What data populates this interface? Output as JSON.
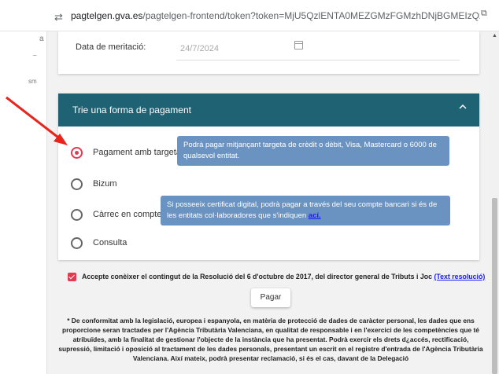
{
  "browser": {
    "url_host": "pagtelgen.gva.es",
    "url_rest": "/pagtelgen-frontend/token?token=MjU5QzlENTA0MEZGMzFGMzhDNjBGMEIzQzlBRTA5NTExNzlxOD...",
    "left_marks": [
      "a",
      "_",
      "sm"
    ]
  },
  "date_section": {
    "label": "Data de meritació:",
    "value": "24/7/2024"
  },
  "payment": {
    "title": "Trie una forma de pagament",
    "options": [
      {
        "label": "Pagament amb targeta",
        "selected": true
      },
      {
        "label": "Bizum",
        "selected": false
      },
      {
        "label": "Càrrec en compte",
        "selected": false
      },
      {
        "label": "Consulta",
        "selected": false
      }
    ],
    "tip_card": "Podrà pagar mitjançant targeta de crèdit o dèbit, Visa, Mastercard o 6000 de qualsevol entitat.",
    "tip_account": "Si posseeix certificat digital, podrà pagar a través del seu compte bancari si és de les entitats col·laboradores que s'indiquen",
    "tip_account_link": "ací."
  },
  "accept": {
    "text": "Accepte conèixer el contingut de la Resolució del 6 d'octubre de 2017, del director general de Tributs i Joc",
    "link": "(Text resolució)"
  },
  "pay_button": "Pagar",
  "legal": "* De conformitat amb la legislació, europea i espanyola, en matèria de protecció de dades de caràcter personal, les dades que ens proporcione seran tractades per l'Agència Tributària Valenciana, en qualitat de responsable i en l'exercici de les competències que té atribuïdes, amb la finalitat de gestionar l'objecte de la instància que ha presentat. Podrà exercir els drets d¿accés, rectificació, supressió, limitació i oposició al tractament de les dades personals, presentant un escrit en el registre d'entrada de l'Agència Tributària Valenciana. Així mateix, podrà presentar reclamació, si és el cas, davant de la Delegació",
  "colors": {
    "header": "#1f6273",
    "tooltip": "#6b93c2",
    "accent": "#e53950",
    "arrow": "#e8241c"
  },
  "icons": [
    "tune-icon",
    "tab-icon",
    "calendar-icon",
    "chevron-up-icon",
    "scroll-up-icon"
  ]
}
